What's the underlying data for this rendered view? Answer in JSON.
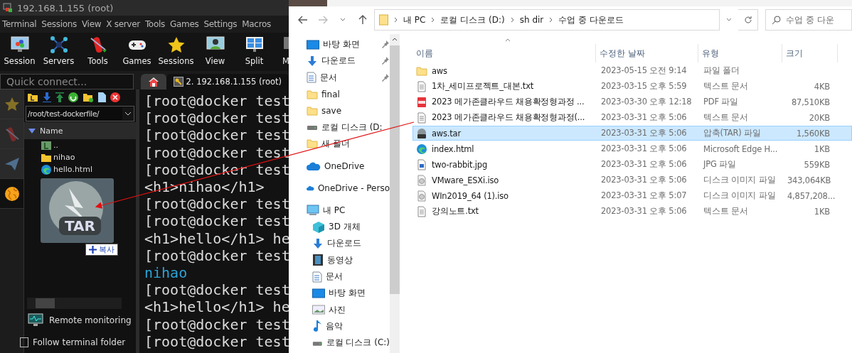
{
  "terminal_app": {
    "title": "192.168.1.155 (root)",
    "menu": [
      "Terminal",
      "Sessions",
      "View",
      "X server",
      "Tools",
      "Games",
      "Settings",
      "Macros"
    ],
    "toolbar": [
      {
        "label": "Session",
        "kind": "session"
      },
      {
        "label": "Servers",
        "kind": "servers"
      },
      {
        "label": "Tools",
        "kind": "tools"
      },
      {
        "label": "Games",
        "kind": "games"
      },
      {
        "label": "Sessions",
        "kind": "star"
      },
      {
        "label": "View",
        "kind": "view"
      },
      {
        "label": "Split",
        "kind": "split"
      },
      {
        "label": "M",
        "kind": "more"
      }
    ],
    "quick_connect": {
      "placeholder": "Quick connect..."
    },
    "tabs": [
      {
        "kind": "home",
        "selected": false
      },
      {
        "kind": "session",
        "label": "2. 192.168.1.155 (root)",
        "selected": true
      }
    ],
    "side_tabs": [
      {
        "kind": "star",
        "selected": false
      },
      {
        "kind": "tools",
        "selected": false
      },
      {
        "kind": "send",
        "selected": false
      },
      {
        "kind": "sftp",
        "selected": true
      }
    ],
    "file_panel": {
      "path": "/root/test-dockerfile/",
      "column": "Name",
      "items": [
        {
          "name": "..",
          "kind": "up"
        },
        {
          "name": "nihao",
          "kind": "folder"
        },
        {
          "name": "hello.html",
          "kind": "edge"
        }
      ]
    },
    "drag": {
      "badge": "TAR",
      "tooltip": "복사"
    },
    "remote_monitoring": "Remote monitoring",
    "follow_terminal_folder": {
      "label": "Follow terminal folder",
      "checked": false
    },
    "terminal_lines": [
      {
        "text": "[root@docker test",
        "kind": "prompt"
      },
      {
        "text": "[root@docker test",
        "kind": "prompt"
      },
      {
        "text": "[root@docker test",
        "kind": "prompt"
      },
      {
        "text": "[root@docker test",
        "kind": "prompt"
      },
      {
        "text": "[root@docker test",
        "kind": "prompt"
      },
      {
        "text": "<h1>nihao</h1>",
        "kind": "output"
      },
      {
        "text": "[root@docker test",
        "kind": "prompt"
      },
      {
        "text": "[root@docker test",
        "kind": "prompt"
      },
      {
        "text": "<h1>hello</h1> he",
        "kind": "output"
      },
      {
        "text": "[root@docker test",
        "kind": "prompt"
      },
      {
        "text": "nihao",
        "kind": "dir"
      },
      {
        "text": "[root@docker test",
        "kind": "prompt"
      },
      {
        "text": "<h1>hello</h1> he",
        "kind": "output"
      },
      {
        "text": "[root@docker test",
        "kind": "prompt"
      },
      {
        "text": "[root@docker test",
        "kind": "prompt"
      }
    ]
  },
  "explorer": {
    "breadcrumb": [
      "내 PC",
      "로컬 디스크 (D:)",
      "sh dir",
      "수업 중 다운로드"
    ],
    "search": {
      "placeholder": "수업 중 다운"
    },
    "nav": [
      {
        "label": "바탕 화면",
        "kind": "desktop",
        "pinned": true
      },
      {
        "label": "다운로드",
        "kind": "download",
        "pinned": true
      },
      {
        "label": "문서",
        "kind": "doc",
        "pinned": true
      },
      {
        "label": "final",
        "kind": "folder",
        "pinned": false
      },
      {
        "label": "save",
        "kind": "folder",
        "pinned": false
      },
      {
        "label": "로컬 디스크 (D:",
        "kind": "drive",
        "pinned": false
      },
      {
        "label": "새 폴더",
        "kind": "folder",
        "pinned": false
      },
      {
        "label": "OneDrive",
        "kind": "cloud",
        "pinned": false
      },
      {
        "label": "OneDrive - Perso",
        "kind": "cloud",
        "pinned": false
      },
      {
        "label": "내 PC",
        "kind": "pc",
        "pinned": false,
        "children": [
          {
            "label": "3D 개체",
            "kind": "cube",
            "pinned": false
          },
          {
            "label": "다운로드",
            "kind": "download",
            "pinned": false
          },
          {
            "label": "동영상",
            "kind": "video",
            "pinned": false
          },
          {
            "label": "문서",
            "kind": "doc",
            "pinned": false
          },
          {
            "label": "바탕 화면",
            "kind": "desktop",
            "pinned": false
          },
          {
            "label": "사진",
            "kind": "photo",
            "pinned": false
          },
          {
            "label": "음악",
            "kind": "music",
            "pinned": false
          },
          {
            "label": "로컬 디스크 (C:)",
            "kind": "drive",
            "pinned": false
          }
        ]
      }
    ],
    "columns": [
      "이름",
      "수정한 날짜",
      "유형",
      "크기"
    ],
    "files": [
      {
        "name": "aws",
        "modified": "2023-05-15 오전 9:14",
        "type": "파일 폴더",
        "kind": "folder",
        "selected": false
      },
      {
        "name": "1차_세미프로젝트_대본.txt",
        "modified": "2023-03-15 오후 5:59",
        "type": "텍스트 문서",
        "size": "4KB",
        "kind": "text",
        "selected": false
      },
      {
        "name": "2023 메가존클라우드 채용확정형과정 ...",
        "modified": "2023-03-30 오후 12:18",
        "type": "PDF 파일",
        "size": "87,510KB",
        "kind": "pdf",
        "selected": false
      },
      {
        "name": "2023 메가존클라우드 채용확정형과정(...",
        "modified": "2023-03-31 오후 5:06",
        "type": "텍스트 문서",
        "size": "20KB",
        "kind": "text",
        "selected": false
      },
      {
        "name": "aws.tar",
        "modified": "2023-03-31 오후 5:06",
        "type": "압축(TAR) 파일",
        "size": "1,560KB",
        "kind": "tar",
        "selected": true
      },
      {
        "name": "index.html",
        "modified": "2023-03-31 오후 5:06",
        "type": "Microsoft Edge H...",
        "size": "1KB",
        "kind": "edge",
        "selected": false
      },
      {
        "name": "two-rabbit.jpg",
        "modified": "2023-03-31 오후 5:06",
        "type": "JPG 파일",
        "size": "559KB",
        "kind": "image",
        "selected": false
      },
      {
        "name": "VMware_ESXi.iso",
        "modified": "2023-03-31 오후 5:06",
        "type": "디스크 이미지 파일",
        "size": "343,064KB",
        "kind": "disc",
        "selected": false
      },
      {
        "name": "WIn2019_64 (1).iso",
        "modified": "2023-03-31 오후 5:07",
        "type": "디스크 이미지 파일",
        "size": "4,857,208...",
        "kind": "disc",
        "selected": false
      },
      {
        "name": "강의노트.txt",
        "modified": "2023-03-31 오후 5:06",
        "type": "텍스트 문서",
        "size": "1KB",
        "kind": "text",
        "selected": false
      }
    ]
  }
}
